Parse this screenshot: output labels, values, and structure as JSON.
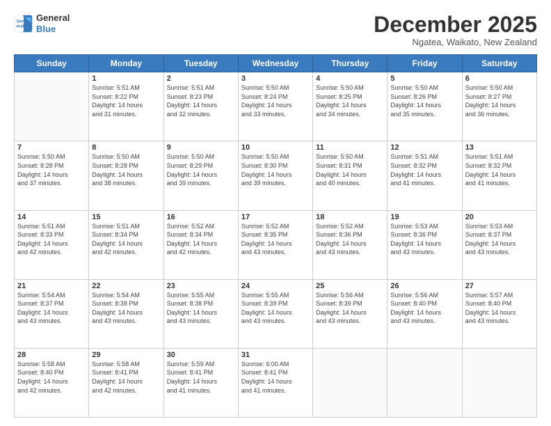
{
  "header": {
    "logo_line1": "General",
    "logo_line2": "Blue",
    "month": "December 2025",
    "location": "Ngatea, Waikato, New Zealand"
  },
  "weekdays": [
    "Sunday",
    "Monday",
    "Tuesday",
    "Wednesday",
    "Thursday",
    "Friday",
    "Saturday"
  ],
  "weeks": [
    [
      {
        "day": "",
        "info": ""
      },
      {
        "day": "1",
        "info": "Sunrise: 5:51 AM\nSunset: 8:22 PM\nDaylight: 14 hours\nand 31 minutes."
      },
      {
        "day": "2",
        "info": "Sunrise: 5:51 AM\nSunset: 8:23 PM\nDaylight: 14 hours\nand 32 minutes."
      },
      {
        "day": "3",
        "info": "Sunrise: 5:50 AM\nSunset: 8:24 PM\nDaylight: 14 hours\nand 33 minutes."
      },
      {
        "day": "4",
        "info": "Sunrise: 5:50 AM\nSunset: 8:25 PM\nDaylight: 14 hours\nand 34 minutes."
      },
      {
        "day": "5",
        "info": "Sunrise: 5:50 AM\nSunset: 8:26 PM\nDaylight: 14 hours\nand 35 minutes."
      },
      {
        "day": "6",
        "info": "Sunrise: 5:50 AM\nSunset: 8:27 PM\nDaylight: 14 hours\nand 36 minutes."
      }
    ],
    [
      {
        "day": "7",
        "info": "Sunrise: 5:50 AM\nSunset: 8:28 PM\nDaylight: 14 hours\nand 37 minutes."
      },
      {
        "day": "8",
        "info": "Sunrise: 5:50 AM\nSunset: 8:28 PM\nDaylight: 14 hours\nand 38 minutes."
      },
      {
        "day": "9",
        "info": "Sunrise: 5:50 AM\nSunset: 8:29 PM\nDaylight: 14 hours\nand 39 minutes."
      },
      {
        "day": "10",
        "info": "Sunrise: 5:50 AM\nSunset: 8:30 PM\nDaylight: 14 hours\nand 39 minutes."
      },
      {
        "day": "11",
        "info": "Sunrise: 5:50 AM\nSunset: 8:31 PM\nDaylight: 14 hours\nand 40 minutes."
      },
      {
        "day": "12",
        "info": "Sunrise: 5:51 AM\nSunset: 8:32 PM\nDaylight: 14 hours\nand 41 minutes."
      },
      {
        "day": "13",
        "info": "Sunrise: 5:51 AM\nSunset: 8:32 PM\nDaylight: 14 hours\nand 41 minutes."
      }
    ],
    [
      {
        "day": "14",
        "info": "Sunrise: 5:51 AM\nSunset: 8:33 PM\nDaylight: 14 hours\nand 42 minutes."
      },
      {
        "day": "15",
        "info": "Sunrise: 5:51 AM\nSunset: 8:34 PM\nDaylight: 14 hours\nand 42 minutes."
      },
      {
        "day": "16",
        "info": "Sunrise: 5:52 AM\nSunset: 8:34 PM\nDaylight: 14 hours\nand 42 minutes."
      },
      {
        "day": "17",
        "info": "Sunrise: 5:52 AM\nSunset: 8:35 PM\nDaylight: 14 hours\nand 43 minutes."
      },
      {
        "day": "18",
        "info": "Sunrise: 5:52 AM\nSunset: 8:36 PM\nDaylight: 14 hours\nand 43 minutes."
      },
      {
        "day": "19",
        "info": "Sunrise: 5:53 AM\nSunset: 8:36 PM\nDaylight: 14 hours\nand 43 minutes."
      },
      {
        "day": "20",
        "info": "Sunrise: 5:53 AM\nSunset: 8:37 PM\nDaylight: 14 hours\nand 43 minutes."
      }
    ],
    [
      {
        "day": "21",
        "info": "Sunrise: 5:54 AM\nSunset: 8:37 PM\nDaylight: 14 hours\nand 43 minutes."
      },
      {
        "day": "22",
        "info": "Sunrise: 5:54 AM\nSunset: 8:38 PM\nDaylight: 14 hours\nand 43 minutes."
      },
      {
        "day": "23",
        "info": "Sunrise: 5:55 AM\nSunset: 8:38 PM\nDaylight: 14 hours\nand 43 minutes."
      },
      {
        "day": "24",
        "info": "Sunrise: 5:55 AM\nSunset: 8:39 PM\nDaylight: 14 hours\nand 43 minutes."
      },
      {
        "day": "25",
        "info": "Sunrise: 5:56 AM\nSunset: 8:39 PM\nDaylight: 14 hours\nand 43 minutes."
      },
      {
        "day": "26",
        "info": "Sunrise: 5:56 AM\nSunset: 8:40 PM\nDaylight: 14 hours\nand 43 minutes."
      },
      {
        "day": "27",
        "info": "Sunrise: 5:57 AM\nSunset: 8:40 PM\nDaylight: 14 hours\nand 43 minutes."
      }
    ],
    [
      {
        "day": "28",
        "info": "Sunrise: 5:58 AM\nSunset: 8:40 PM\nDaylight: 14 hours\nand 42 minutes."
      },
      {
        "day": "29",
        "info": "Sunrise: 5:58 AM\nSunset: 8:41 PM\nDaylight: 14 hours\nand 42 minutes."
      },
      {
        "day": "30",
        "info": "Sunrise: 5:59 AM\nSunset: 8:41 PM\nDaylight: 14 hours\nand 41 minutes."
      },
      {
        "day": "31",
        "info": "Sunrise: 6:00 AM\nSunset: 8:41 PM\nDaylight: 14 hours\nand 41 minutes."
      },
      {
        "day": "",
        "info": ""
      },
      {
        "day": "",
        "info": ""
      },
      {
        "day": "",
        "info": ""
      }
    ]
  ]
}
